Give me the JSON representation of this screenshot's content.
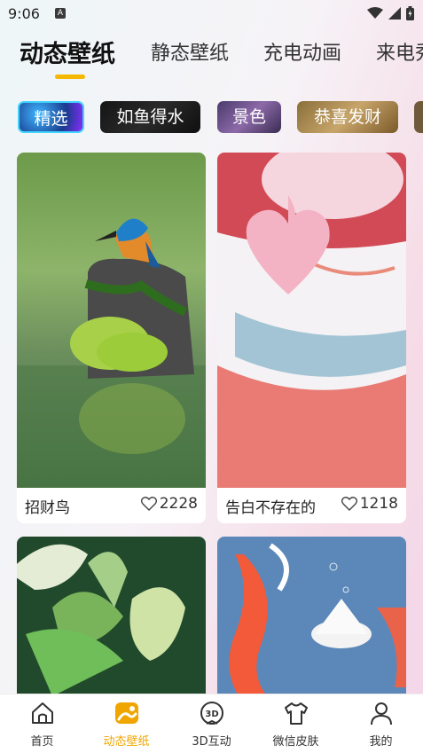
{
  "status": {
    "time": "9:06",
    "notif_letter": "A"
  },
  "top_tabs": [
    {
      "label": "动态壁纸",
      "active": true
    },
    {
      "label": "静态壁纸"
    },
    {
      "label": "充电动画"
    },
    {
      "label": "来电秀"
    }
  ],
  "chips": [
    {
      "label": "精选",
      "selected": true
    },
    {
      "label": "如鱼得水"
    },
    {
      "label": "景色"
    },
    {
      "label": "恭喜发财"
    }
  ],
  "cards": [
    {
      "title": "招财鸟",
      "likes": "2228",
      "image": "kingfisher-on-rock"
    },
    {
      "title": "告白不存在的",
      "likes": "1218",
      "image": "pig-in-hanfu-heart"
    },
    {
      "title": "",
      "likes": "",
      "image": "green-lotus"
    },
    {
      "title": "",
      "likes": "",
      "image": "koi-and-lotus"
    }
  ],
  "nav": [
    {
      "label": "首页",
      "icon": "home-icon"
    },
    {
      "label": "动态壁纸",
      "icon": "wallpaper-icon",
      "active": true
    },
    {
      "label": "3D互动",
      "icon": "3d-icon"
    },
    {
      "label": "微信皮肤",
      "icon": "shirt-icon"
    },
    {
      "label": "我的",
      "icon": "person-icon"
    }
  ],
  "colors": {
    "accent": "#f5b800",
    "nav_active": "#f0a500"
  }
}
